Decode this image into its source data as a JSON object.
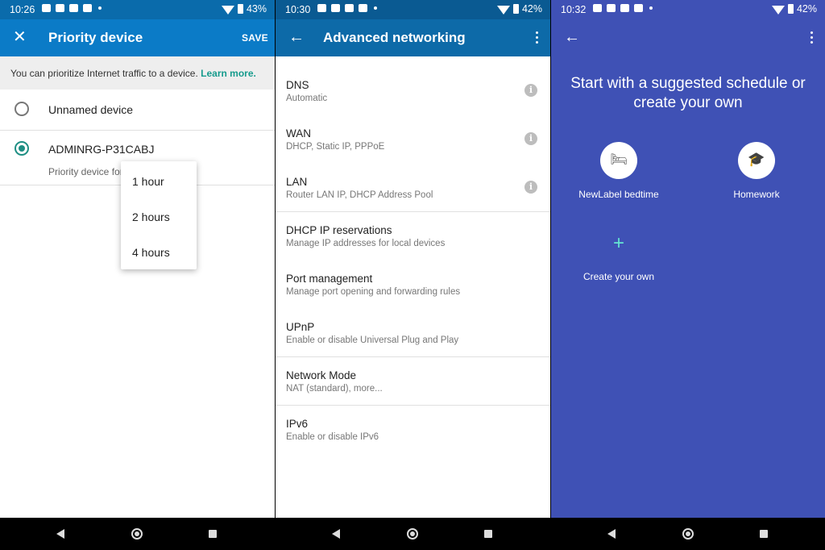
{
  "panel1": {
    "status": {
      "time": "10:26",
      "battery": "43%"
    },
    "appbar": {
      "close_icon": "close-icon",
      "title": "Priority device",
      "action": "SAVE"
    },
    "info": {
      "text": "You can prioritize Internet traffic to a device.",
      "link": "Learn more."
    },
    "devices": [
      {
        "name": "Unnamed device",
        "selected": false
      },
      {
        "name": "ADMINRG-P31CABJ",
        "selected": true,
        "subtitle": "Priority device for"
      }
    ],
    "menu": [
      "1 hour",
      "2 hours",
      "4 hours"
    ]
  },
  "panel2": {
    "status": {
      "time": "10:30",
      "battery": "42%"
    },
    "appbar": {
      "title": "Advanced networking"
    },
    "rows": [
      {
        "title": "DNS",
        "subtitle": "Automatic",
        "info": true
      },
      {
        "title": "WAN",
        "subtitle": "DHCP, Static IP, PPPoE",
        "info": true
      },
      {
        "title": "LAN",
        "subtitle": "Router LAN IP, DHCP Address Pool",
        "info": true
      },
      {
        "title": "DHCP IP reservations",
        "subtitle": "Manage IP addresses for local devices"
      },
      {
        "title": "Port management",
        "subtitle": "Manage port opening and forwarding rules"
      },
      {
        "title": "UPnP",
        "subtitle": "Enable or disable Universal Plug and Play"
      },
      {
        "title": "Network Mode",
        "subtitle": "NAT (standard), more..."
      },
      {
        "title": "IPv6",
        "subtitle": "Enable or disable IPv6"
      }
    ]
  },
  "panel3": {
    "status": {
      "time": "10:32",
      "battery": "42%"
    },
    "headline_line1": "Start with a suggested schedule or",
    "headline_line2": "create your own",
    "options": [
      {
        "label": "NewLabel bedtime",
        "icon": "bed-icon"
      },
      {
        "label": "Homework",
        "icon": "graduation-cap-icon"
      }
    ],
    "create_label": "Create your own"
  },
  "colors": {
    "teal": "#1e8e83",
    "blue_bar": "#0b7bc7",
    "adv_bar": "#0d6aa8",
    "indigo": "#3f51b5"
  }
}
